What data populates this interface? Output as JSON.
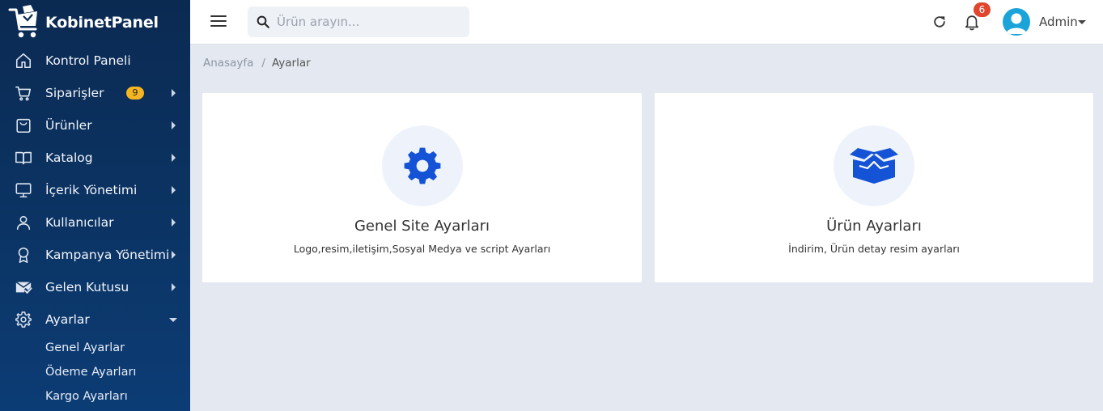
{
  "brand": {
    "name": "KobinetPanel"
  },
  "sidebar": {
    "items": [
      {
        "label": "Kontrol Paneli",
        "icon": "home-icon"
      },
      {
        "label": "Siparişler",
        "icon": "cart-icon",
        "badge": "9"
      },
      {
        "label": "Ürünler",
        "icon": "bag-icon"
      },
      {
        "label": "Katalog",
        "icon": "book-icon"
      },
      {
        "label": "İçerik Yönetimi",
        "icon": "monitor-icon"
      },
      {
        "label": "Kullanıcılar",
        "icon": "user-icon"
      },
      {
        "label": "Kampanya Yönetimi",
        "icon": "award-icon"
      },
      {
        "label": "Gelen Kutusu",
        "icon": "mail-check-icon"
      },
      {
        "label": "Ayarlar",
        "icon": "gear-icon"
      }
    ],
    "submenu": [
      {
        "label": "Genel Ayarlar"
      },
      {
        "label": "Ödeme Ayarları"
      },
      {
        "label": "Kargo Ayarları"
      }
    ]
  },
  "topbar": {
    "search_placeholder": "Ürün arayın...",
    "notifications_count": "6",
    "user_name": "Admin"
  },
  "breadcrumb": {
    "home": "Anasayfa",
    "separator": "/",
    "current": "Ayarlar"
  },
  "cards": [
    {
      "title": "Genel Site Ayarları",
      "description": "Logo,resim,iletişim,Sosyal Medya ve script Ayarları",
      "icon": "gear-icon"
    },
    {
      "title": "Ürün Ayarları",
      "description": "İndirim, Ürün detay resim ayarları",
      "icon": "open-box-icon"
    }
  ],
  "colors": {
    "sidebar_bg": "#0b2a52",
    "accent": "#1553d6",
    "badge_warn": "#f5b521",
    "badge_danger": "#e0452d",
    "avatar": "#1aa4d9",
    "page_bg": "#e4e9f1"
  }
}
